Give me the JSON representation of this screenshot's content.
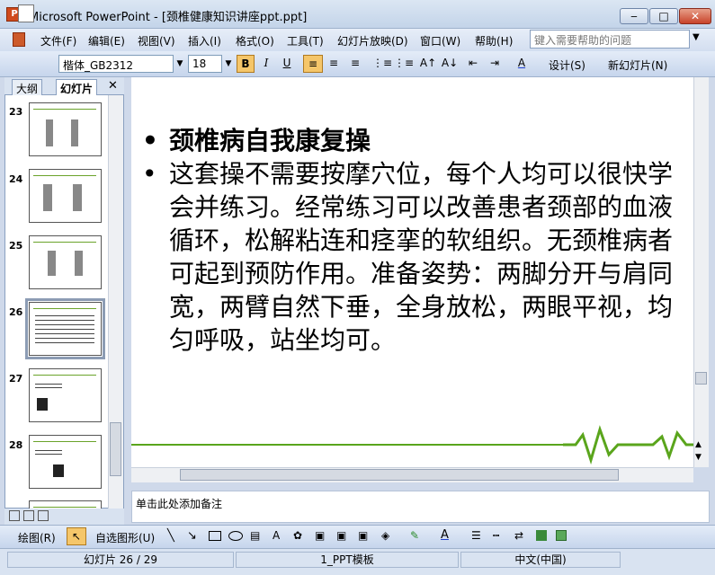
{
  "window": {
    "title": "Microsoft PowerPoint - [颈椎健康知识讲座ppt.ppt]",
    "app_icon": "P"
  },
  "menu": [
    "文件(F)",
    "编辑(E)",
    "视图(V)",
    "插入(I)",
    "格式(O)",
    "工具(T)",
    "幻灯片放映(D)",
    "窗口(W)",
    "帮助(H)"
  ],
  "help": {
    "placeholder": "键入需要帮助的问题"
  },
  "toolbar": {
    "font": "楷体_GB2312",
    "size": "18",
    "bold": "B",
    "italic": "I",
    "underline": "U",
    "design": "设计(S)",
    "new_slide": "新幻灯片(N)"
  },
  "panel": {
    "tab_outline": "大纲",
    "tab_slides": "幻灯片",
    "close": "✕",
    "slide_numbers": [
      "23",
      "24",
      "25",
      "26",
      "27",
      "28"
    ]
  },
  "slide": {
    "heading": "颈椎病自我康复操",
    "body": "这套操不需要按摩穴位，每个人均可以很快学会并练习。经常练习可以改善患者颈部的血液循环，松解粘连和痉挛的软组织。无颈椎病者可起到预防作用。准备姿势：两脚分开与肩同宽，两臂自然下垂，全身放松，两眼平视，均匀呼吸，站坐均可。"
  },
  "notes": {
    "placeholder": "单击此处添加备注"
  },
  "drawbar": {
    "draw": "绘图(R)",
    "autoshape": "自选图形(U)"
  },
  "status": {
    "slide_pos": "幻灯片 26 / 29",
    "template": "1_PPT模板",
    "language": "中文(中国)"
  },
  "colors": {
    "accent_green": "#5aa51c"
  }
}
